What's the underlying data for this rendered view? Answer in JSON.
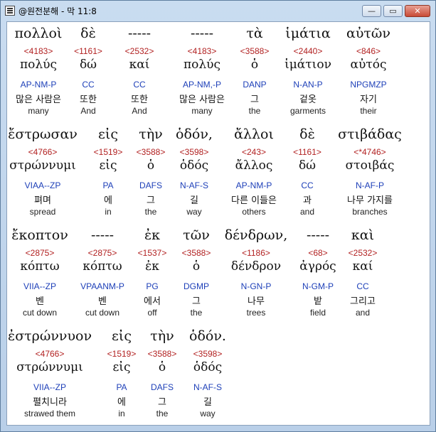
{
  "window": {
    "title": "@원전분해 - 막 11:8",
    "buttons": {
      "minimize": "—",
      "maximize": "▭",
      "close": "✕"
    }
  },
  "verses": [
    {
      "words": [
        {
          "greek": "πολλοὶ",
          "strongs": "<4183>",
          "lemma": "πολύς",
          "parsing": "AP-NM-P",
          "korean": "많은 사람은",
          "english": "many"
        },
        {
          "greek": "δὲ",
          "strongs": "<1161>",
          "lemma": "δώ",
          "parsing": "CC",
          "korean": "또한",
          "english": "And"
        },
        {
          "greek": "-----",
          "strongs": "<2532>",
          "lemma": "καί",
          "parsing": "CC",
          "korean": "또한",
          "english": "And"
        },
        {
          "greek": "-----",
          "strongs": "<4183>",
          "lemma": "πολύς",
          "parsing": "AP-NM,-P",
          "korean": "많은 사람은",
          "english": "many"
        },
        {
          "greek": "τὰ",
          "strongs": "<3588>",
          "lemma": "ὁ",
          "parsing": "DANP",
          "korean": "그",
          "english": "the"
        },
        {
          "greek": "ἱμάτια",
          "strongs": "<2440>",
          "lemma": "ἱμάτιον",
          "parsing": "N-AN-P",
          "korean": "겉옷",
          "english": "garments"
        },
        {
          "greek": "αὐτῶν",
          "strongs": "<846>",
          "lemma": "αὐτός",
          "parsing": "NPGMZP",
          "korean": "자기",
          "english": "their"
        }
      ]
    },
    {
      "words": [
        {
          "greek": "ἔστρωσαν",
          "strongs": "<4766>",
          "lemma": "στρώννυμι",
          "parsing": "VIAA--ZP",
          "korean": "펴며",
          "english": "spread"
        },
        {
          "greek": "εἰς",
          "strongs": "<1519>",
          "lemma": "εἰς",
          "parsing": "PA",
          "korean": "에",
          "english": "in"
        },
        {
          "greek": "τὴν",
          "strongs": "<3588>",
          "lemma": "ὁ",
          "parsing": "DAFS",
          "korean": "그",
          "english": "the"
        },
        {
          "greek": "ὁδόν,",
          "strongs": "<3598>",
          "lemma": "ὁδός",
          "parsing": "N-AF-S",
          "korean": "길",
          "english": "way"
        },
        {
          "greek": "ἄλλοι",
          "strongs": "<243>",
          "lemma": "ἄλλος",
          "parsing": "AP-NM-P",
          "korean": "다른 이들은",
          "english": "others"
        },
        {
          "greek": "δὲ",
          "strongs": "<1161>",
          "lemma": "δώ",
          "parsing": "CC",
          "korean": "과",
          "english": "and"
        },
        {
          "greek": "στιβάδας",
          "strongs": "<*4746>",
          "lemma": "στοιβάς",
          "parsing": "N-AF-P",
          "korean": "나무 가지를",
          "english": "branches"
        }
      ]
    },
    {
      "words": [
        {
          "greek": "ἔκοπτον",
          "strongs": "<2875>",
          "lemma": "κόπτω",
          "parsing": "VIIA--ZP",
          "korean": "벤",
          "english": "cut down"
        },
        {
          "greek": "-----",
          "strongs": "<2875>",
          "lemma": "κόπτω",
          "parsing": "VPAANM-P",
          "korean": "벤",
          "english": "cut down"
        },
        {
          "greek": "ἐκ",
          "strongs": "<1537>",
          "lemma": "ἐκ",
          "parsing": "PG",
          "korean": "에서",
          "english": "off"
        },
        {
          "greek": "τῶν",
          "strongs": "<3588>",
          "lemma": "ὁ",
          "parsing": "DGMP",
          "korean": "그",
          "english": "the"
        },
        {
          "greek": "δένδρων,",
          "strongs": "<1186>",
          "lemma": "δένδρον",
          "parsing": "N-GN-P",
          "korean": "나무",
          "english": "trees"
        },
        {
          "greek": "-----",
          "strongs": "<68>",
          "lemma": "ἀγρός",
          "parsing": "N-GM-P",
          "korean": "밭",
          "english": "field"
        },
        {
          "greek": "καὶ",
          "strongs": "<2532>",
          "lemma": "καί",
          "parsing": "CC",
          "korean": "그리고",
          "english": "and"
        }
      ]
    },
    {
      "words": [
        {
          "greek": "ἐστρώννυον",
          "strongs": "<4766>",
          "lemma": "στρώννυμι",
          "parsing": "VIIA--ZP",
          "korean": "펼치니라",
          "english": "strawed them"
        },
        {
          "greek": "εἰς",
          "strongs": "<1519>",
          "lemma": "εἰς",
          "parsing": "PA",
          "korean": "에",
          "english": "in"
        },
        {
          "greek": "τὴν",
          "strongs": "<3588>",
          "lemma": "ὁ",
          "parsing": "DAFS",
          "korean": "그",
          "english": "the"
        },
        {
          "greek": "ὁδόν.",
          "strongs": "<3598>",
          "lemma": "ὁδός",
          "parsing": "N-AF-S",
          "korean": "길",
          "english": "way"
        }
      ]
    }
  ]
}
